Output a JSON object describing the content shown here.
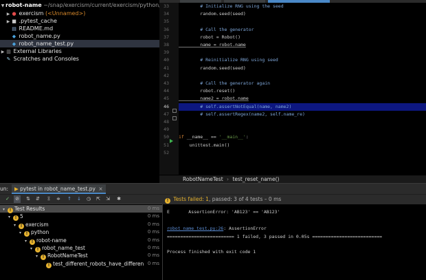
{
  "project": {
    "root": {
      "name": "robot-name",
      "path": "~/snap/exercism/current/exercism/python/robot-"
    },
    "items": [
      {
        "name": "exercism",
        "tag": "(<Unnamed>)"
      },
      {
        "name": ".pytest_cache"
      },
      {
        "name": "README.md"
      },
      {
        "name": "robot_name.py"
      },
      {
        "name": "robot_name_test.py"
      },
      {
        "name": "External Libraries"
      },
      {
        "name": "Scratches and Consoles"
      }
    ]
  },
  "editor": {
    "lines": [
      {
        "n": "33",
        "code": "        # Initialize RNG using the seed"
      },
      {
        "n": "34",
        "code": "        random.seed(seed)"
      },
      {
        "n": "35",
        "code": ""
      },
      {
        "n": "36",
        "code": "        # Call the generator"
      },
      {
        "n": "37",
        "code": "        robot = Robot()"
      },
      {
        "n": "38",
        "code": "        name = robot.name"
      },
      {
        "n": "39",
        "code": ""
      },
      {
        "n": "40",
        "code": "        # Reinitialize RNG using seed"
      },
      {
        "n": "41",
        "code": "        random.seed(seed)"
      },
      {
        "n": "42",
        "code": ""
      },
      {
        "n": "43",
        "code": "        # Call the generator again"
      },
      {
        "n": "44",
        "code": "        robot.reset()"
      },
      {
        "n": "45",
        "code": "        name2 = robot.name"
      },
      {
        "n": "46",
        "code": "        # self.assertNotEqual(name, name2)"
      },
      {
        "n": "47",
        "code": "        # self.assertRegex(name2, self.name_re)"
      },
      {
        "n": "48",
        "code": ""
      },
      {
        "n": "49",
        "code": ""
      },
      {
        "n": "50",
        "kw": "if",
        "mid": " __name__ == ",
        "str": "'__main__'",
        "end": ":"
      },
      {
        "n": "51",
        "code": "    unittest.main()"
      },
      {
        "n": "52",
        "code": ""
      }
    ],
    "breadcrumb": {
      "cls": "RobotNameTest",
      "sep": "›",
      "method": "test_reset_name()"
    }
  },
  "run": {
    "label": "un:",
    "tab": "pytest in robot_name_test.py",
    "status": {
      "failed": "Tests failed:",
      "failed_count": "1",
      "passed_text": ", passed: 3 of 4 tests",
      "time": "– 0 ms"
    },
    "tree": [
      {
        "label": "Test Results",
        "time": "0 ms",
        "depth": 0,
        "sel": true
      },
      {
        "label": "5",
        "time": "0 ms",
        "depth": 1
      },
      {
        "label": "exercism",
        "time": "0 ms",
        "depth": 2
      },
      {
        "label": "python",
        "time": "0 ms",
        "depth": 3
      },
      {
        "label": "robot-name",
        "time": "0 ms",
        "depth": 4
      },
      {
        "label": "robot_name_test",
        "time": "0 ms",
        "depth": 5
      },
      {
        "label": "RobotNameTest",
        "time": "0 ms",
        "depth": 6
      },
      {
        "label": "test_different_robots_have_differen",
        "time": "0 ms",
        "depth": 7
      }
    ],
    "console": [
      "E       AssertionError: 'AB123' == 'AB123'",
      "",
      "",
      "robot_name_test.py:26",
      "========================= 1 failed, 3 passed in 0.05s ==========================",
      "",
      "Process finished with exit code 1"
    ],
    "console_link_suffix": ": AssertionError"
  }
}
